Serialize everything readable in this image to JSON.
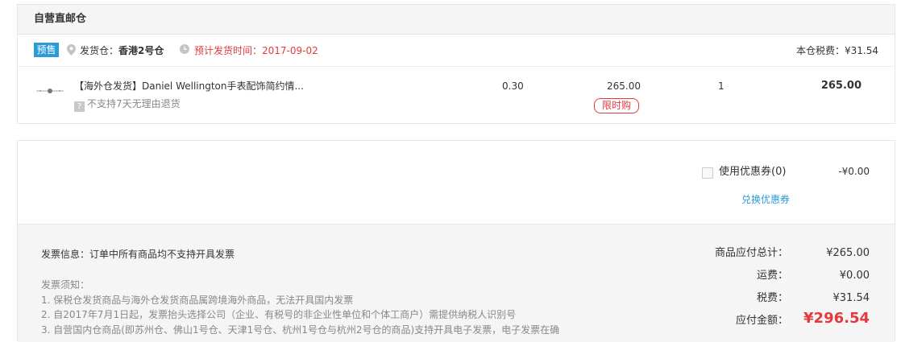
{
  "warehouse": {
    "title": "自营直邮仓",
    "presale_badge": "预售",
    "ship_from_label": "发货仓：",
    "ship_from_value": "香港2号仓",
    "eta_label": "预计发货时间：2017-09-02",
    "tax_label": "本仓税费：¥31.54"
  },
  "item": {
    "title": "【海外仓发货】Daniel Wellington手表配饰简约情...",
    "badge": "?",
    "return_policy": "不支持7天无理由退货",
    "weight": "0.30",
    "unit_price": "265.00",
    "flash_tag": "限时购",
    "quantity": "1",
    "subtotal": "265.00"
  },
  "coupon": {
    "label": "使用优惠券(0)",
    "value": "-¥0.00",
    "redeem_link": "兑换优惠券"
  },
  "invoice": {
    "info": "发票信息：订单中所有商品均不支持开具发票",
    "notes_title": "发票须知：",
    "notes": [
      "1. 保税仓发货商品与海外仓发货商品属跨境海外商品，无法开具国内发票",
      "2. 自2017年7月1日起，发票抬头选择公司（企业、有税号的非企业性单位和个体工商户）需提供纳税人识别号",
      "3. 自营国内仓商品(即苏州仓、佛山1号仓、天津1号仓、杭州1号仓与杭州2号仓的商品)支持开具电子发票，电子发票在确"
    ]
  },
  "totals": {
    "goods_label": "商品应付总计：",
    "goods_value": "¥265.00",
    "shipping_label": "运费：",
    "shipping_value": "¥0.00",
    "tax_label": "税费：",
    "tax_value": "¥31.54",
    "grand_label": "应付金额：",
    "grand_value": "¥296.54"
  },
  "colors": {
    "accent_red": "#e4393c",
    "accent_blue": "#2b9bd8"
  }
}
